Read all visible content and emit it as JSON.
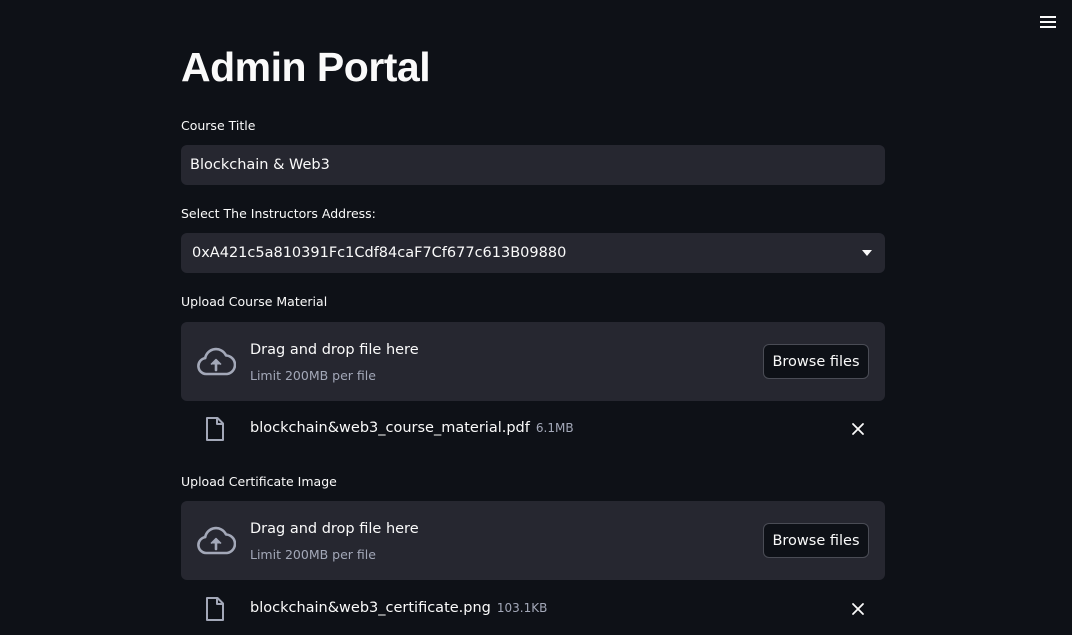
{
  "header": {
    "menu_icon": "hamburger-menu-icon"
  },
  "page": {
    "title": "Admin Portal"
  },
  "course_title": {
    "label": "Course Title",
    "value": "Blockchain & Web3"
  },
  "instructor": {
    "label": "Select The Instructors Address:",
    "selected": "0xA421c5a810391Fc1Cdf84caF7Cf677c613B09880",
    "icon": "chevron-down-icon"
  },
  "course_material": {
    "label": "Upload Course Material",
    "dropzone_text": "Drag and drop file here",
    "dropzone_limit": "Limit 200MB per file",
    "browse_label": "Browse files",
    "file": {
      "name": "blockchain&web3_course_material.pdf",
      "size": "6.1MB"
    }
  },
  "certificate": {
    "label": "Upload Certificate Image",
    "dropzone_text": "Drag and drop file here",
    "dropzone_limit": "Limit 200MB per file",
    "browse_label": "Browse files",
    "file": {
      "name": "blockchain&web3_certificate.png",
      "size": "103.1KB"
    }
  },
  "colors": {
    "background": "#0e1117",
    "widget_bg": "#262730",
    "text": "#fafafa",
    "muted_text": "#a3a8b8"
  }
}
